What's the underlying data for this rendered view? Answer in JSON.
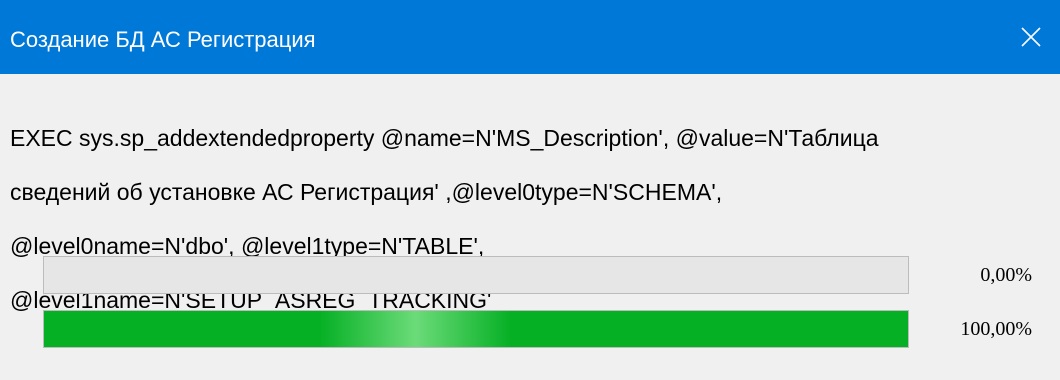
{
  "window": {
    "title": "Создание БД АС Регистрация"
  },
  "message": {
    "lines": [
      "EXEC sys.sp_addextendedproperty @name=N'MS_Description', @value=N'Таблица",
      "сведений об установке АС Регистрация' ,@level0type=N'SCHEMA',",
      "@level0name=N'dbo', @level1type=N'TABLE',",
      "@level1name=N'SETUP_ASREG_TRACKING'"
    ]
  },
  "progress": [
    {
      "value_percent": 0,
      "label": "0,00%"
    },
    {
      "value_percent": 100,
      "label": "100,00%"
    }
  ],
  "colors": {
    "titlebar": "#0078d7",
    "progress_fill": "#06b025",
    "progress_track": "#e6e6e6"
  },
  "icons": {
    "close": "close-icon"
  }
}
